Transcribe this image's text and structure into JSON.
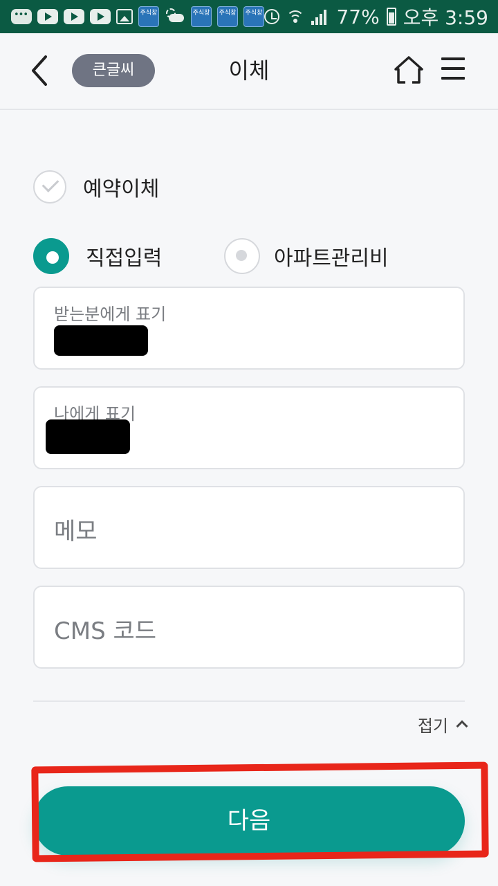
{
  "status_bar": {
    "app_icon_label": "주식창",
    "battery": "77%",
    "time": "오후 3:59"
  },
  "header": {
    "big_text_label": "큰글씨",
    "title": "이체"
  },
  "options": {
    "scheduled_transfer": {
      "label": "예약이체",
      "checked": false
    },
    "input_mode": {
      "selected": "direct",
      "direct_label": "직접입력",
      "apartment_label": "아파트관리비"
    }
  },
  "fields": {
    "recipient_display": {
      "label": "받는분에게 표기"
    },
    "my_display": {
      "label": "나에게 표기"
    },
    "memo": {
      "placeholder": "메모"
    },
    "cms_code": {
      "placeholder": "CMS 코드"
    }
  },
  "collapse_label": "접기",
  "next_button_label": "다음",
  "colors": {
    "accent": "#0a9a8f",
    "status_bar": "#0b5a43",
    "highlight": "#e8261a"
  }
}
